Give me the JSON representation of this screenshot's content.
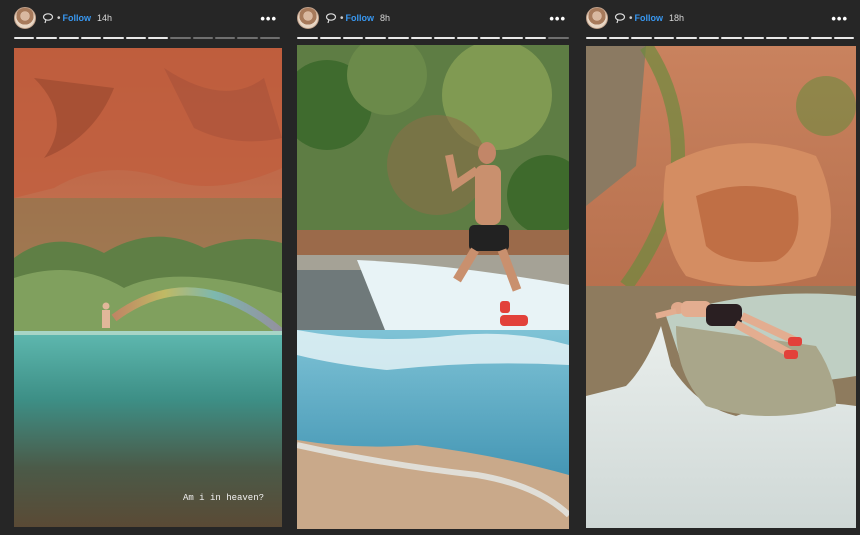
{
  "stories": [
    {
      "follow_label": "Follow",
      "time": "14h",
      "more": "•••",
      "caption": "Am i in heaven?",
      "progress": {
        "segments": 12,
        "viewed": 7
      }
    },
    {
      "follow_label": "Follow",
      "time": "8h",
      "more": "•••",
      "progress": {
        "segments": 12,
        "viewed": 11
      }
    },
    {
      "follow_label": "Follow",
      "time": "18h",
      "more": "•••",
      "progress": {
        "segments": 12,
        "viewed": 12
      }
    }
  ],
  "icons": {
    "avatar": "profile-avatar",
    "verify": "lasso-icon",
    "more": "more-options-icon"
  },
  "colors": {
    "follow": "#3897f0",
    "background": "#262626"
  }
}
